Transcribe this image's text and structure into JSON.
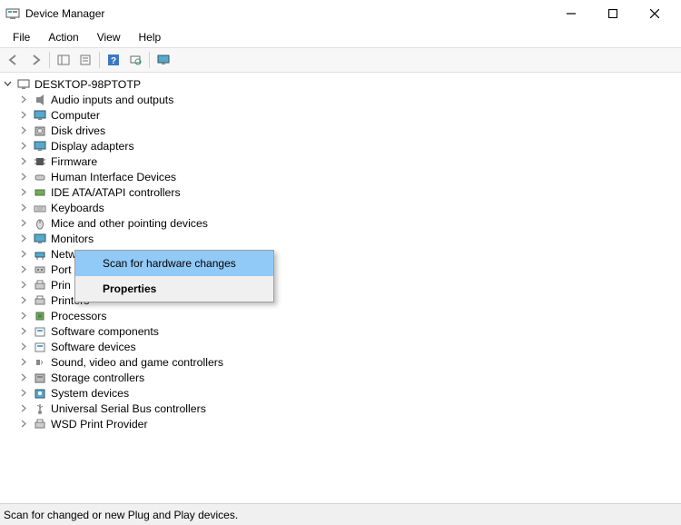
{
  "titlebar": {
    "title": "Device Manager"
  },
  "menubar": {
    "items": [
      "File",
      "Action",
      "View",
      "Help"
    ]
  },
  "toolbar": {
    "buttons": [
      {
        "name": "back-icon"
      },
      {
        "name": "forward-icon"
      },
      {
        "name": "show-hide-tree-icon"
      },
      {
        "name": "properties-icon"
      },
      {
        "name": "help-icon"
      },
      {
        "name": "scan-icon"
      },
      {
        "name": "monitor-icon"
      }
    ]
  },
  "tree": {
    "root_label": "DESKTOP-98PTOTP",
    "items": [
      {
        "label": "Audio inputs and outputs",
        "icon": "speaker"
      },
      {
        "label": "Computer",
        "icon": "monitor"
      },
      {
        "label": "Disk drives",
        "icon": "disk"
      },
      {
        "label": "Display adapters",
        "icon": "monitor"
      },
      {
        "label": "Firmware",
        "icon": "chip"
      },
      {
        "label": "Human Interface Devices",
        "icon": "hid"
      },
      {
        "label": "IDE ATA/ATAPI controllers",
        "icon": "ide"
      },
      {
        "label": "Keyboards",
        "icon": "keyboard"
      },
      {
        "label": "Mice and other pointing devices",
        "icon": "mouse"
      },
      {
        "label": "Monitors",
        "icon": "monitor"
      },
      {
        "label": "Netw",
        "icon": "network",
        "truncated": true
      },
      {
        "label": "Port",
        "icon": "port",
        "truncated": true
      },
      {
        "label": "Prin",
        "icon": "printer",
        "truncated": true
      },
      {
        "label": "Printers",
        "icon": "printer"
      },
      {
        "label": "Processors",
        "icon": "cpu"
      },
      {
        "label": "Software components",
        "icon": "software"
      },
      {
        "label": "Software devices",
        "icon": "software"
      },
      {
        "label": "Sound, video and game controllers",
        "icon": "sound"
      },
      {
        "label": "Storage controllers",
        "icon": "storage"
      },
      {
        "label": "System devices",
        "icon": "system"
      },
      {
        "label": "Universal Serial Bus controllers",
        "icon": "usb"
      },
      {
        "label": "WSD Print Provider",
        "icon": "printer"
      }
    ]
  },
  "context_menu": {
    "items": [
      {
        "label": "Scan for hardware changes",
        "highlighted": true
      },
      {
        "label": "Properties",
        "bold": true
      }
    ]
  },
  "statusbar": {
    "text": "Scan for changed or new Plug and Play devices."
  }
}
